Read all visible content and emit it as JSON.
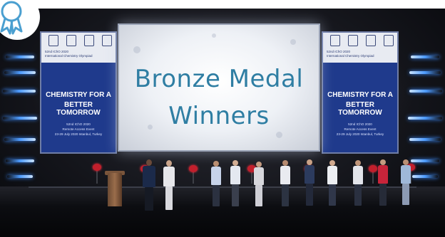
{
  "main_screen": {
    "line1": "Bronze Medal",
    "line2": "Winners"
  },
  "side_screen": {
    "top_line1": "52nd IChO 2020",
    "top_line2": "International Chemistry Olympiad",
    "headline1": "CHEMISTRY FOR A",
    "headline2": "BETTER TOMORROW",
    "footer_line1": "52nd IChO 2020",
    "footer_line2": "Remote Access Event",
    "footer_line3": "23-29 July 2020 Istanbul, Turkey"
  },
  "colors": {
    "title_text": "#2f7ea3",
    "side_screen_bg": "#1f3a8c",
    "stage_light": "#4d9bff",
    "flowers": "#c21f2c"
  },
  "icons": {
    "badge": "award-ribbon-icon"
  }
}
